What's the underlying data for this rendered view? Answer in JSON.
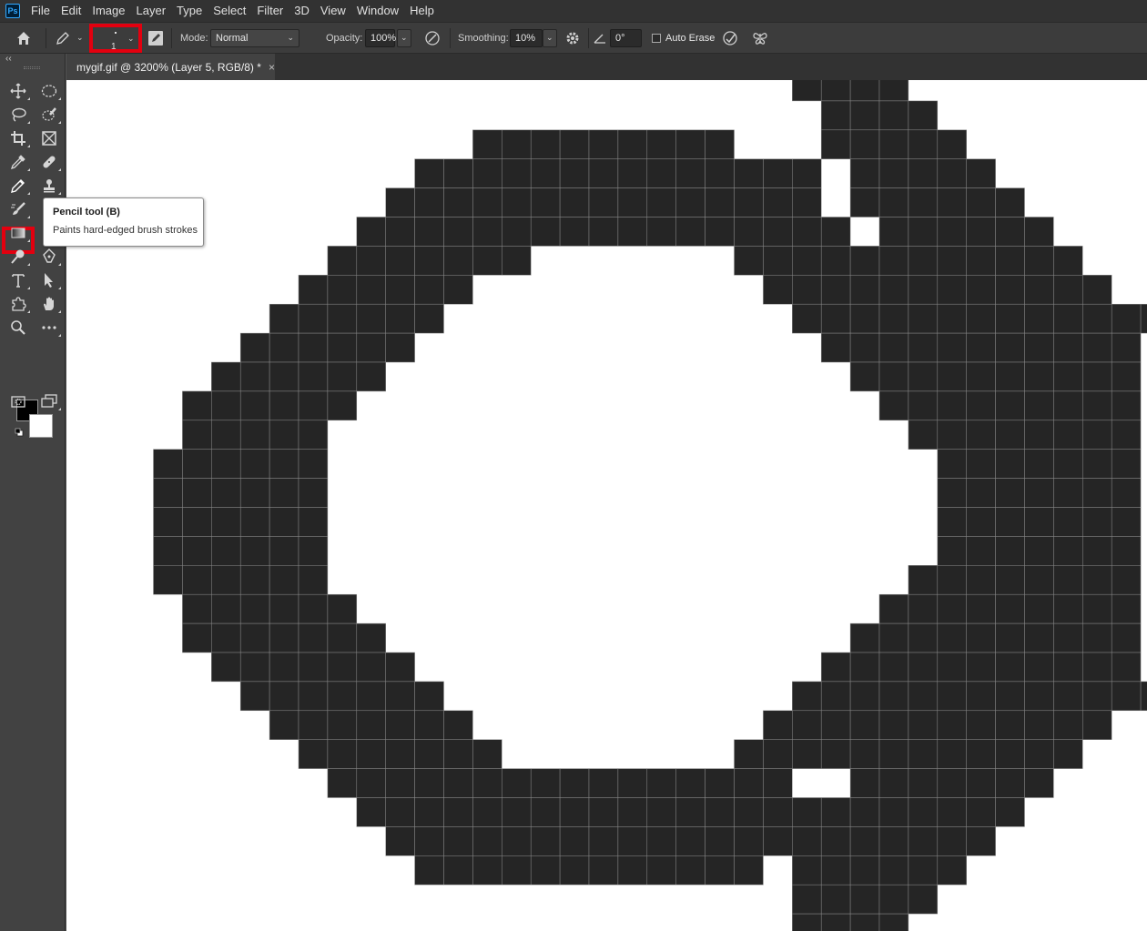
{
  "app": {
    "logo_text": "Ps"
  },
  "menu": [
    "File",
    "Edit",
    "Image",
    "Layer",
    "Type",
    "Select",
    "Filter",
    "3D",
    "View",
    "Window",
    "Help"
  ],
  "options_bar": {
    "brush_size": "1",
    "mode_label": "Mode:",
    "mode_value": "Normal",
    "opacity_label": "Opacity:",
    "opacity_value": "100%",
    "smoothing_label": "Smoothing:",
    "smoothing_value": "10%",
    "angle_value": "0°",
    "auto_erase_label": "Auto Erase",
    "auto_erase_checked": false
  },
  "document_tab": {
    "title": "mygif.gif @ 3200% (Layer 5, RGB/8) *",
    "close_glyph": "×"
  },
  "toolbar": {
    "collapse_glyph": "‹‹",
    "active_tool": "pencil-tool",
    "foreground_color": "#000000",
    "background_color": "#ffffff",
    "tools": [
      "move",
      "elliptical-marquee",
      "lasso",
      "quick-selection",
      "crop",
      "frame",
      "eyedropper",
      "healing-brush",
      "pencil",
      "clone-stamp",
      "mixer-brush",
      "history-brush",
      "gradient",
      "blur",
      "dodge",
      "pen",
      "type",
      "path-selection",
      "custom-shape",
      "hand",
      "zoom",
      "more",
      "quick-mask",
      "screen-mode"
    ]
  },
  "tooltip": {
    "title": "Pencil tool (B)",
    "description": "Paints hard-edged brush strokes"
  },
  "canvas": {
    "pixel_color": "#252525",
    "grid_color": "#8a8a8a",
    "background": "#ffffff",
    "pixel_rows": [
      [
        [
          25,
          28
        ]
      ],
      [
        [
          26,
          29
        ]
      ],
      [
        [
          14,
          22
        ],
        [
          26,
          30
        ]
      ],
      [
        [
          12,
          25
        ],
        [
          27,
          31
        ]
      ],
      [
        [
          11,
          25
        ],
        [
          27,
          32
        ]
      ],
      [
        [
          10,
          26
        ],
        [
          28,
          33
        ]
      ],
      [
        [
          9,
          15
        ],
        [
          23,
          28
        ],
        [
          29,
          34
        ]
      ],
      [
        [
          8,
          13
        ],
        [
          24,
          29
        ],
        [
          30,
          35
        ]
      ],
      [
        [
          7,
          12
        ],
        [
          25,
          30
        ],
        [
          31,
          37
        ]
      ],
      [
        [
          6,
          11
        ],
        [
          26,
          36
        ]
      ],
      [
        [
          5,
          10
        ],
        [
          27,
          36
        ]
      ],
      [
        [
          4,
          9
        ],
        [
          28,
          36
        ]
      ],
      [
        [
          4,
          8
        ],
        [
          29,
          36
        ]
      ],
      [
        [
          3,
          8
        ],
        [
          30,
          36
        ]
      ],
      [
        [
          3,
          8
        ],
        [
          30,
          36
        ]
      ],
      [
        [
          3,
          8
        ],
        [
          30,
          36
        ]
      ],
      [
        [
          3,
          8
        ],
        [
          30,
          36
        ]
      ],
      [
        [
          3,
          8
        ],
        [
          29,
          36
        ]
      ],
      [
        [
          4,
          9
        ],
        [
          28,
          36
        ]
      ],
      [
        [
          4,
          10
        ],
        [
          27,
          36
        ]
      ],
      [
        [
          5,
          11
        ],
        [
          26,
          36
        ]
      ],
      [
        [
          6,
          12
        ],
        [
          25,
          30
        ],
        [
          31,
          37
        ]
      ],
      [
        [
          7,
          13
        ],
        [
          24,
          29
        ],
        [
          30,
          35
        ]
      ],
      [
        [
          8,
          14
        ],
        [
          23,
          28
        ],
        [
          29,
          34
        ]
      ],
      [
        [
          9,
          24
        ],
        [
          27,
          33
        ]
      ],
      [
        [
          10,
          25
        ],
        [
          26,
          32
        ]
      ],
      [
        [
          11,
          25
        ],
        [
          26,
          31
        ]
      ],
      [
        [
          12,
          23
        ],
        [
          25,
          30
        ]
      ],
      [
        [
          25,
          29
        ]
      ],
      [
        [
          25,
          28
        ]
      ],
      [
        [
          24,
          28
        ]
      ]
    ]
  }
}
